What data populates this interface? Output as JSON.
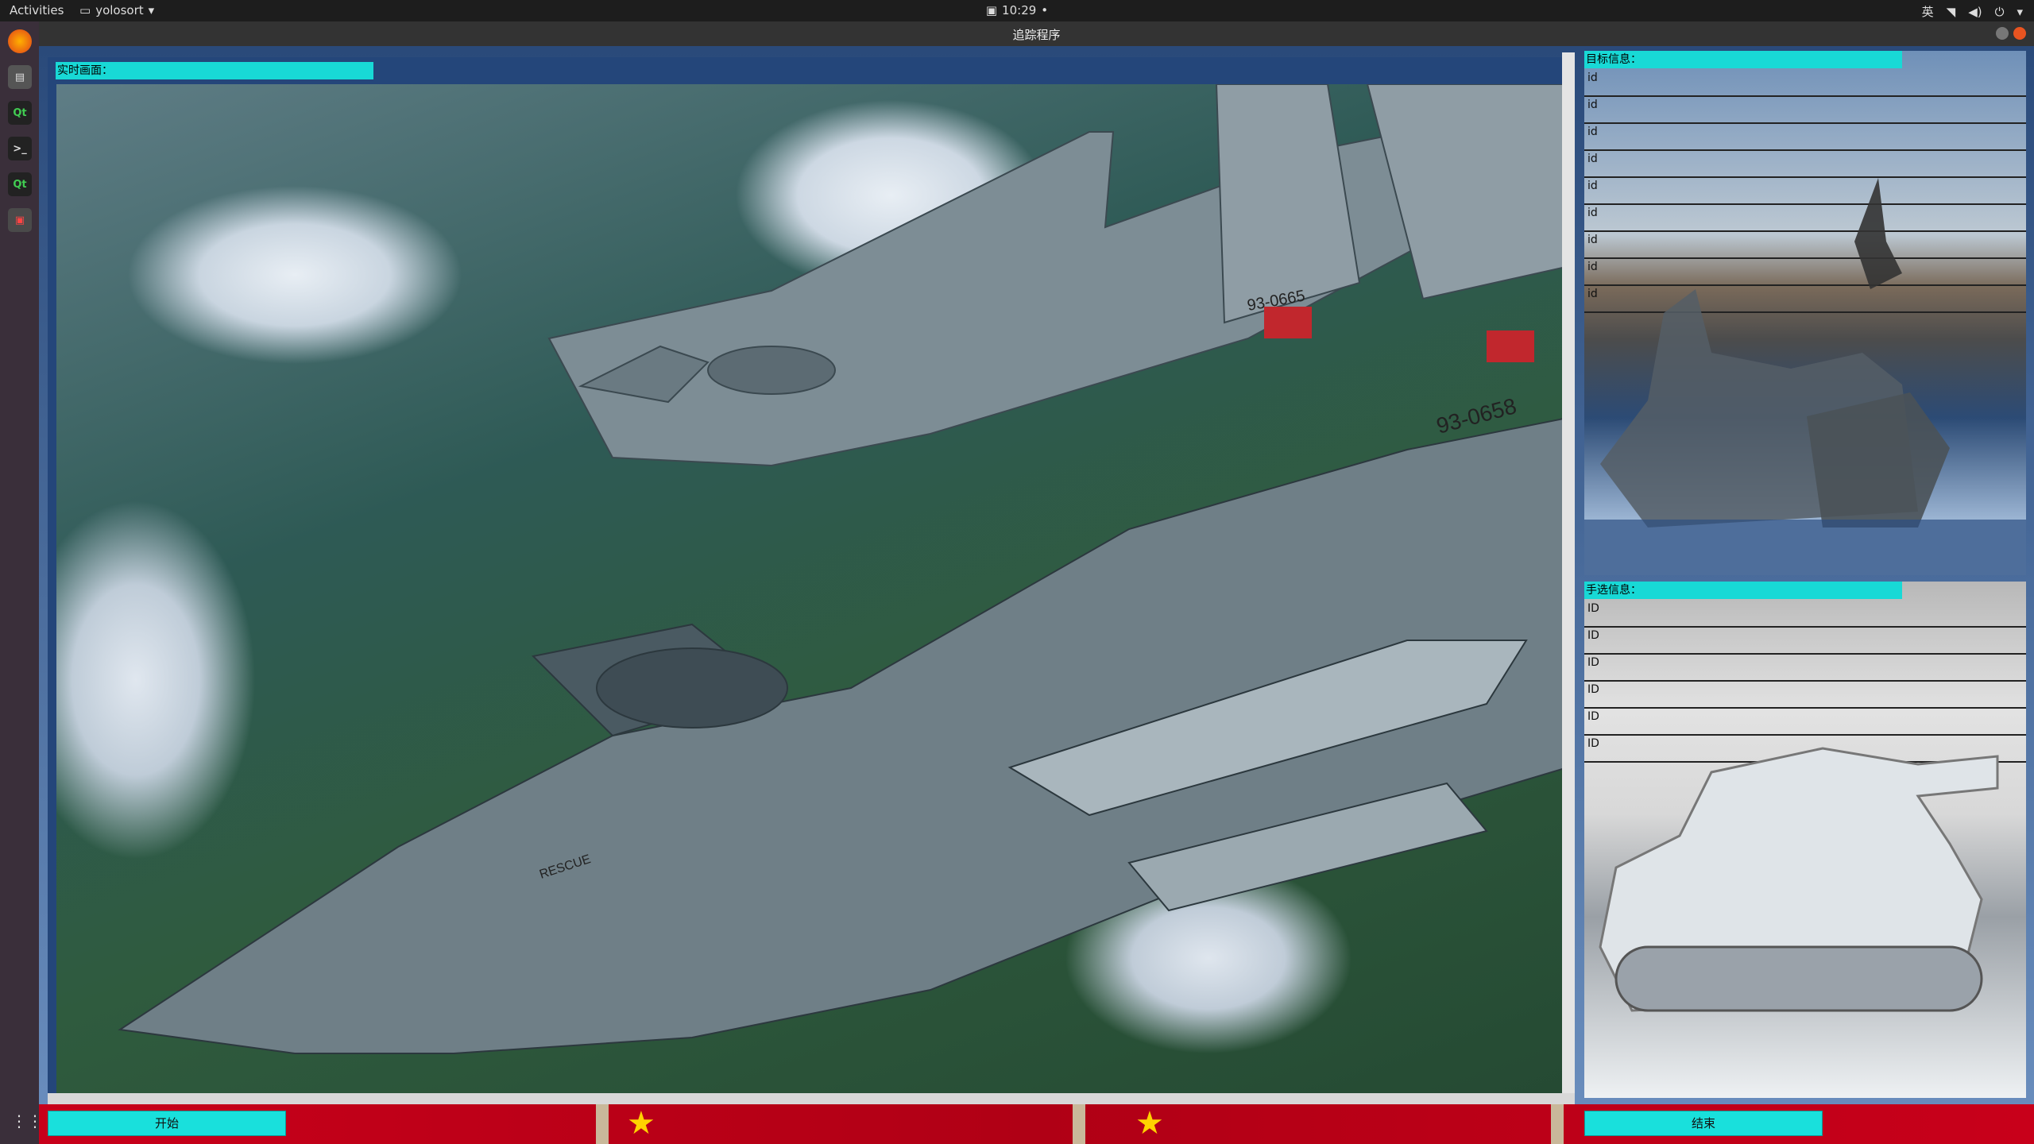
{
  "topbar": {
    "activities": "Activities",
    "app_menu": "yolosort",
    "clock": "10:29",
    "input_method": "英"
  },
  "window": {
    "title": "追踪程序"
  },
  "video": {
    "label": "实时画面："
  },
  "target_panel": {
    "label": "目标信息：",
    "rows": [
      "id",
      "id",
      "id",
      "id",
      "id",
      "id",
      "id",
      "id",
      "id"
    ]
  },
  "manual_panel": {
    "label": "手选信息：",
    "rows": [
      "ID",
      "ID",
      "ID",
      "ID",
      "ID",
      "ID"
    ]
  },
  "buttons": {
    "start": "开始",
    "end": "结束"
  },
  "jets": {
    "tail_a": "93-0665",
    "tail_b": "93-0658",
    "rescue": "RESCUE"
  },
  "colors": {
    "accent": "#18d9d6",
    "button": "#19e0dc",
    "flag_red": "#c8001a"
  }
}
